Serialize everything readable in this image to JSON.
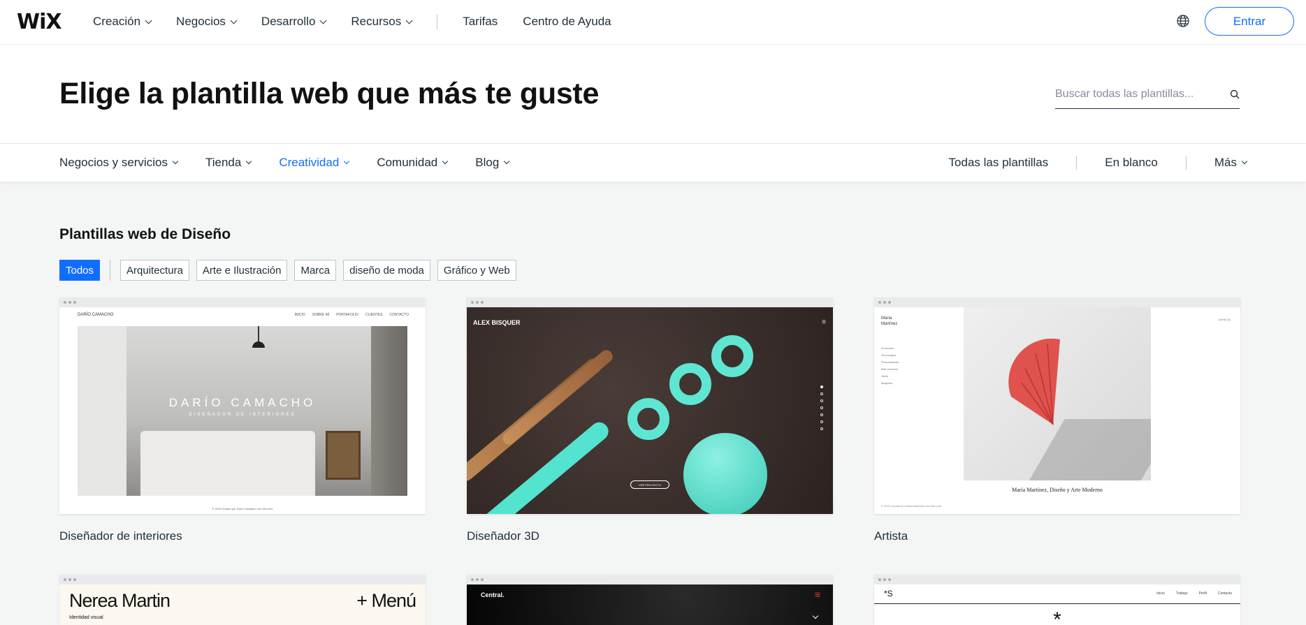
{
  "brand": {
    "logo": "WiX"
  },
  "nav": {
    "items": [
      {
        "label": "Creación",
        "dropdown": true
      },
      {
        "label": "Negocios",
        "dropdown": true
      },
      {
        "label": "Desarrollo",
        "dropdown": true
      },
      {
        "label": "Recursos",
        "dropdown": true
      }
    ],
    "links": [
      "Tarifas",
      "Centro de Ayuda"
    ],
    "globe_icon": "globe-icon",
    "login_label": "Entrar"
  },
  "hero": {
    "title": "Elige la plantilla web que más te guste",
    "search_placeholder": "Buscar todas las plantillas..."
  },
  "categories": {
    "items": [
      {
        "label": "Negocios y servicios",
        "active": false
      },
      {
        "label": "Tienda",
        "active": false
      },
      {
        "label": "Creatividad",
        "active": true
      },
      {
        "label": "Comunidad",
        "active": false
      },
      {
        "label": "Blog",
        "active": false
      }
    ],
    "right": [
      "Todas las plantillas",
      "En blanco",
      "Más"
    ]
  },
  "section": {
    "title": "Plantillas web de Diseño",
    "filters": [
      {
        "label": "Todos",
        "active": true
      },
      {
        "label": "Arquitectura",
        "active": false
      },
      {
        "label": "Arte e Ilustración",
        "active": false
      },
      {
        "label": "Marca",
        "active": false
      },
      {
        "label": "diseño de moda",
        "active": false
      },
      {
        "label": "Gráfico y Web",
        "active": false
      }
    ]
  },
  "templates": [
    {
      "name": "Diseñador de interiores",
      "preview": {
        "brand": "DARÍO CAMACHO",
        "menu": [
          "INICIO",
          "SOBRE MÍ",
          "PORTAFOLIO",
          "CLIENTES",
          "CONTACTO"
        ],
        "headline": "DARÍO CAMACHO",
        "subline": "DISEÑADOR DE INTERIORES",
        "footer": "© 2023 Creado por Darío Camacho con Wix.com"
      }
    },
    {
      "name": "Diseñador 3D",
      "preview": {
        "brand": "ALEX BISQUER",
        "button": "VER PROYECTO"
      }
    },
    {
      "name": "Artista",
      "preview": {
        "brand_line1": "María",
        "brand_line2": "Martínez",
        "menu": [
          "Productos",
          "Tecnologías",
          "Personalizado",
          "Más servicios",
          "Tarde",
          "Biografía"
        ],
        "cart": "Carrito (0)",
        "caption": "María Martínez, Diseño y Arte Moderno",
        "footer": "© 2023 Creado por María Martínez con Wix.com"
      }
    },
    {
      "name": "",
      "preview": {
        "brand": "Nerea Martin",
        "menu": "+ Menú",
        "tagline": "Identidad visual"
      }
    },
    {
      "name": "",
      "preview": {
        "brand": "Central.",
        "hamburger": "≡"
      }
    },
    {
      "name": "",
      "preview": {
        "brand": "*S",
        "menu": [
          "Inicio",
          "Trabajo",
          "Perfil",
          "Contacto"
        ],
        "mark": "*"
      }
    }
  ],
  "colors": {
    "accent": "#116dff",
    "text": "#20303c",
    "page_bg": "#f4f6f6"
  }
}
